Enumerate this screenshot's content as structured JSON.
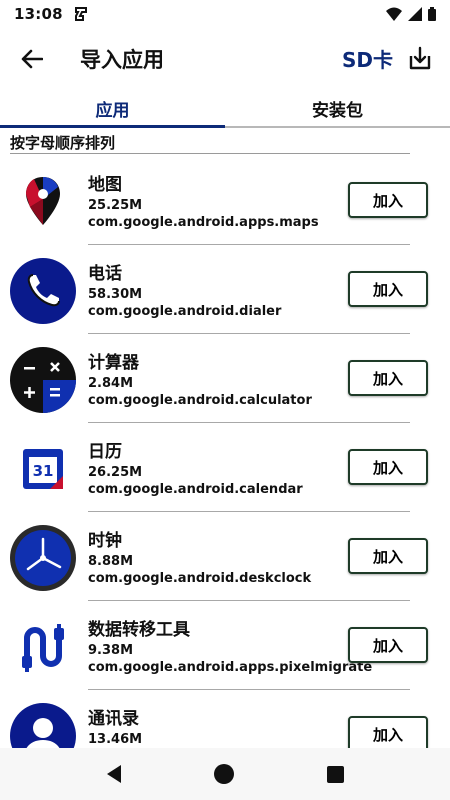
{
  "status_bar": {
    "time": "13:08"
  },
  "app_bar": {
    "title": "导入应用",
    "sd_label": "SD卡"
  },
  "tabs": [
    {
      "label": "应用",
      "active": true
    },
    {
      "label": "安装包",
      "active": false
    }
  ],
  "section_header": "按字母顺序排列",
  "add_label": "加入",
  "apps": [
    {
      "name": "地图",
      "size": "25.25M",
      "package": "com.google.android.apps.maps",
      "icon": "maps-icon"
    },
    {
      "name": "电话",
      "size": "58.30M",
      "package": "com.google.android.dialer",
      "icon": "phone-icon"
    },
    {
      "name": "计算器",
      "size": "2.84M",
      "package": "com.google.android.calculator",
      "icon": "calculator-icon"
    },
    {
      "name": "日历",
      "size": "26.25M",
      "package": "com.google.android.calendar",
      "icon": "calendar-icon"
    },
    {
      "name": "时钟",
      "size": "8.88M",
      "package": "com.google.android.deskclock",
      "icon": "clock-icon"
    },
    {
      "name": "数据转移工具",
      "size": "9.38M",
      "package": "com.google.android.apps.pixelmigrate",
      "icon": "data-transfer-icon"
    },
    {
      "name": "通讯录",
      "size": "13.46M",
      "package": "",
      "icon": "contacts-icon"
    }
  ],
  "colors": {
    "accent": "#0d2a78",
    "button_border": "#1e3b28"
  }
}
